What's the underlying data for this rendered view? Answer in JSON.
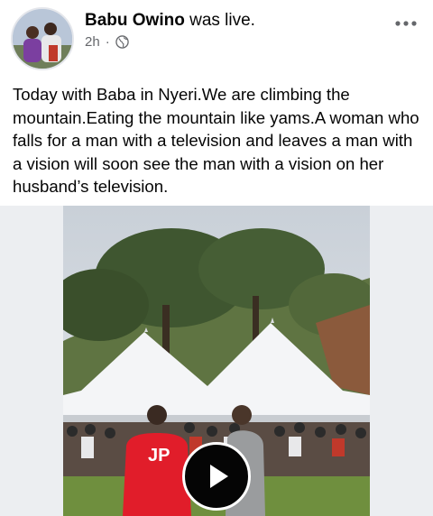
{
  "post": {
    "author_name": "Babu Owino",
    "author_action": "was live.",
    "time": "2h",
    "separator": "·",
    "audience_icon": "globe-icon",
    "more_icon": "more-horizontal-icon",
    "text": "Today with Baba in Nyeri.We are climbing the mountain.Eating the mountain like yams.A woman who falls for a man with a television and leaves a man with a vision will soon see the man with a vision on her husband’s television."
  },
  "video": {
    "shirt_logo": "JP",
    "play_icon": "play-icon"
  },
  "colors": {
    "meta_gray": "#65676b",
    "text": "#050505",
    "media_bg": "#eceef1",
    "play_button": "#050505"
  }
}
